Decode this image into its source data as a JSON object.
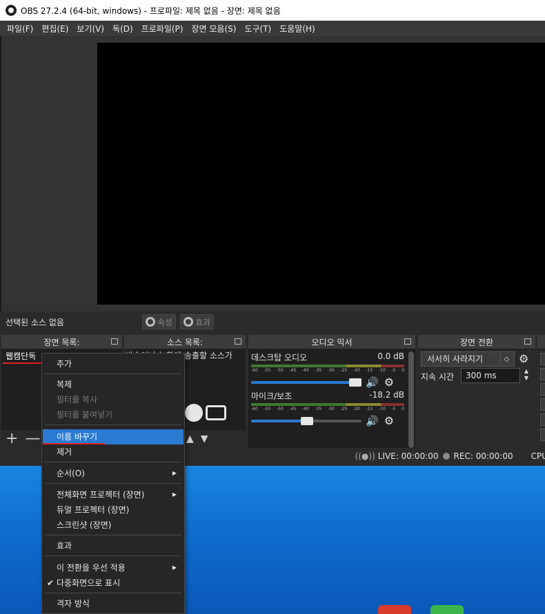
{
  "window": {
    "title": "OBS 27.2.4 (64-bit, windows) - 프로파일: 제목 없음 - 장면: 제목 없음"
  },
  "menubar": {
    "items": [
      "파일(F)",
      "편집(E)",
      "보기(V)",
      "독(D)",
      "프로파일(P)",
      "장면 모음(S)",
      "도구(T)",
      "도움말(H)"
    ]
  },
  "context_bar": {
    "no_source": "선택된 소스 없음",
    "properties": "속성",
    "filters": "효과"
  },
  "docks": {
    "scenes": {
      "title": "장면 목록:",
      "items": [
        "웹캠단독"
      ],
      "add": "+",
      "remove": "—"
    },
    "sources": {
      "title": "소스 목록:",
      "text_lines": "방송이나 녹화에 송출할 소스가\n 지 않습니다.\n 을 누르거나\n 릭하여 소스를\n 십시오.",
      "up": "▲",
      "down": "▼"
    },
    "mixer": {
      "title": "오디오 믹서",
      "channels": [
        {
          "name": "데스크탑 오디오",
          "level": "0.0 dB",
          "volume": 0.95
        },
        {
          "name": "마이크/보조",
          "level": "-18.2 dB",
          "volume": 0.5
        }
      ],
      "scale": [
        "-60",
        "-55",
        "-50",
        "-45",
        "-40",
        "-35",
        "-30",
        "-25",
        "-20",
        "-15",
        "-10",
        "-5",
        "0"
      ]
    },
    "transitions": {
      "title": "장면 전환",
      "selected": "서서히 사라지기",
      "duration_label": "지속 시간",
      "duration_value": "300 ms"
    }
  },
  "status": {
    "live": "LIVE: 00:00:00",
    "rec": "REC: 00:00:00",
    "cpu": "CPU"
  },
  "context_menu": {
    "items": [
      {
        "label": "추가",
        "state": "normal"
      },
      {
        "label": "복제",
        "state": "normal"
      },
      {
        "label": "필터를 복사",
        "state": "disabled"
      },
      {
        "label": "필터를 붙여넣기",
        "state": "disabled"
      },
      {
        "label": "이름 바꾸기",
        "state": "active"
      },
      {
        "label": "제거",
        "state": "normal"
      },
      {
        "label": "순서(O)",
        "state": "submenu"
      },
      {
        "label": "전체화면 프로젝터 (장면)",
        "state": "submenu"
      },
      {
        "label": "듀얼 프로젝터 (장면)",
        "state": "normal"
      },
      {
        "label": "스크린샷 (장면)",
        "state": "normal"
      },
      {
        "label": "효과",
        "state": "normal"
      },
      {
        "label": "이 전환을 우선 적용",
        "state": "submenu"
      },
      {
        "label": "다중화면으로 표시",
        "state": "checked"
      },
      {
        "label": "격자 방식",
        "state": "normal"
      }
    ]
  },
  "colors": {
    "accent": "#2a7ad2",
    "annotation": "#e02020",
    "desktop": "#0f6fd0"
  }
}
